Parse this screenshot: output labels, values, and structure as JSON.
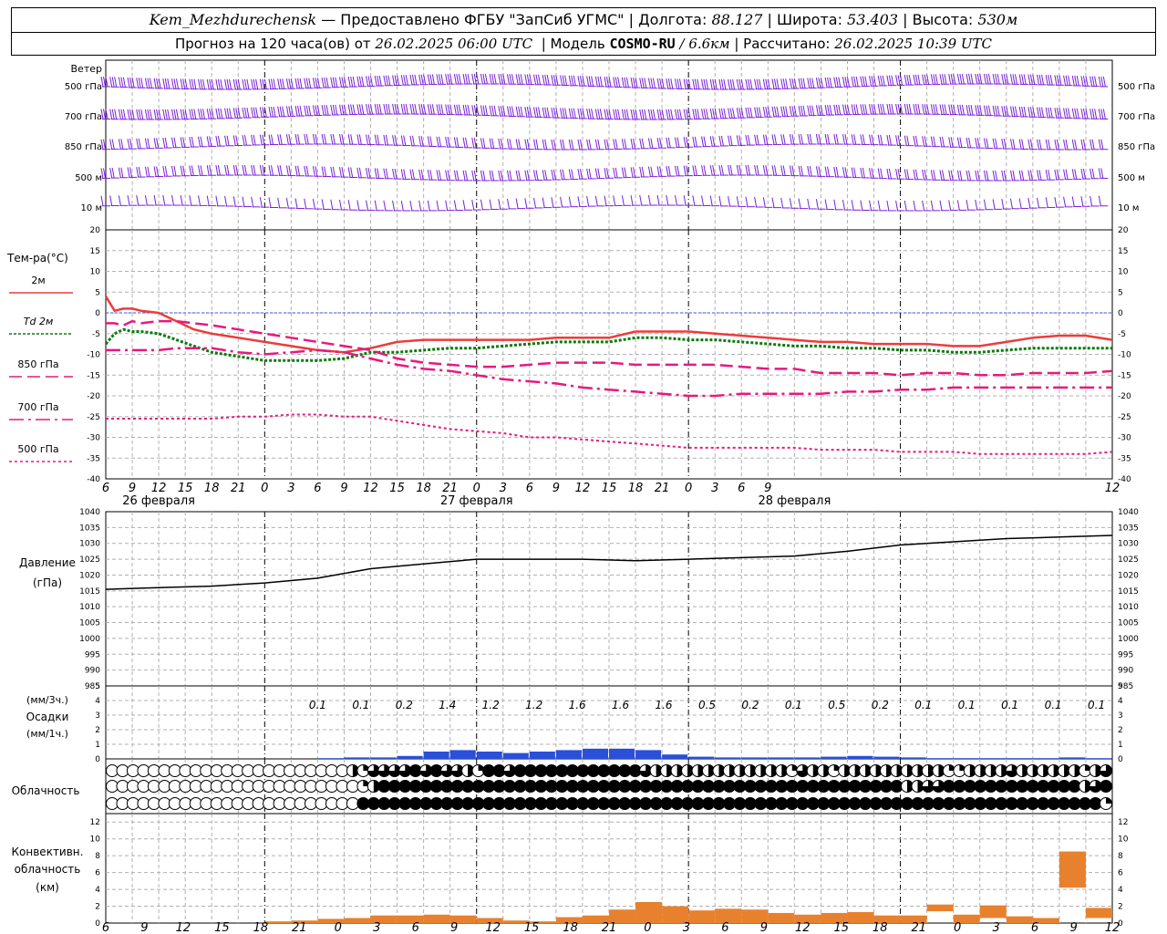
{
  "header": {
    "station": "Kem_Mezhdurechensk",
    "provider": "— Предоставлено ФГБУ \"ЗапСиб УГМС\"",
    "lon_label": "Долгота:",
    "lon_value": "88.127",
    "lat_label": "Широта:",
    "lat_value": "53.403",
    "alt_label": "Высота:",
    "alt_value": "530м",
    "forecast_prefix": "Прогноз на 120 часа(ов) от",
    "forecast_start": "26.02.2025 06:00 UTC",
    "model_label": "Модель",
    "model_name": "COSMO-RU",
    "model_res": "/ 6.6км",
    "computed_label": "Рассчитано:",
    "computed_time": "26.02.2025 10:39 UTC"
  },
  "colors": {
    "wind": "#7b1fd8",
    "t2m": "#ee3b3b",
    "td2m": "#0a7a0a",
    "t850": "#e6197e",
    "t700": "#e6197e",
    "t500": "#e6197e",
    "zero_line": "#3355ee",
    "pressure": "#000000",
    "precip": "#2a4fd9",
    "convective": "#e8812e"
  },
  "wind_panel": {
    "title": "Ветер",
    "levels": [
      "500 гПа",
      "700 гПа",
      "850 гПа",
      "500 м",
      "10 м"
    ]
  },
  "temp_panel": {
    "ylabel": "Тем-ра(°C)",
    "legend": [
      {
        "label": "2м",
        "key": "t2m",
        "style": "solid"
      },
      {
        "label": "Td 2м",
        "key": "td2m",
        "style": "dotted"
      },
      {
        "label": "850 гПа",
        "key": "t850",
        "style": "dash"
      },
      {
        "label": "700 гПа",
        "key": "t700",
        "style": "dashdot"
      },
      {
        "label": "500 гПа",
        "key": "t500",
        "style": "dot"
      }
    ],
    "yticks": [
      "20",
      "15",
      "10",
      "5",
      "0",
      "-5",
      "-10",
      "-15",
      "-20",
      "-25",
      "-30",
      "-35",
      "-40"
    ]
  },
  "pressure_panel": {
    "ylabel": "Давление",
    "unit": "(гПа)",
    "yticks": [
      "1040",
      "1035",
      "1030",
      "1025",
      "1020",
      "1015",
      "1010",
      "1005",
      "1000",
      "995",
      "990",
      "985"
    ]
  },
  "precip_panel": {
    "unit_top": "(мм/3ч.)",
    "ylabel": "Осадки",
    "unit_bottom": "(мм/1ч.)",
    "yticks": [
      "5",
      "4",
      "3",
      "2",
      "1",
      "0"
    ],
    "amounts": [
      "0.1",
      "0.1",
      "0.2",
      "1.4",
      "1.2",
      "1.2",
      "1.6",
      "1.6",
      "1.6",
      "0.5",
      "0.2",
      "0.1",
      "0.5",
      "0.2",
      "0.1",
      "0.1",
      "0.1",
      "0.1",
      "0.1"
    ]
  },
  "cloud_panel": {
    "ylabel": "Облачность"
  },
  "conv_panel": {
    "ylabel1": "Конвективн.",
    "ylabel2": "облачность",
    "unit": "(км)",
    "yticks": [
      "12",
      "10",
      "8",
      "6",
      "4",
      "2",
      "0"
    ]
  },
  "time_axis": {
    "hour_labels": [
      "6",
      "9",
      "12",
      "15",
      "18",
      "21",
      "0",
      "3",
      "6",
      "9",
      "12",
      "15",
      "18",
      "21",
      "0",
      "3",
      "6",
      "9",
      "12",
      "15",
      "18",
      "21",
      "0",
      "3",
      "6",
      "9",
      "12"
    ],
    "dates": [
      "26 февраля",
      "27 февраля",
      "28 февраля"
    ]
  },
  "chart_data": [
    {
      "type": "line",
      "title": "Тем-ра(°C)",
      "x_hours_from_start": [
        0,
        1,
        2,
        3,
        4,
        6,
        8,
        10,
        12,
        15,
        18,
        21,
        24,
        27,
        30,
        33,
        36,
        39,
        42,
        45,
        48,
        51,
        54,
        57,
        60,
        63,
        66,
        69,
        72,
        75,
        78,
        81,
        84,
        87,
        90,
        93,
        96,
        99,
        102,
        105,
        108,
        111,
        114
      ],
      "ylim": [
        -40,
        20
      ],
      "series": [
        {
          "name": "2м",
          "key": "t2m",
          "values": [
            4,
            0.5,
            1,
            1,
            0.5,
            0,
            -2,
            -4,
            -5,
            -6,
            -7,
            -8,
            -9,
            -9.5,
            -8.5,
            -7,
            -6.5,
            -6.5,
            -6.5,
            -6.5,
            -6.5,
            -6,
            -6,
            -6,
            -4.5,
            -4.5,
            -4.5,
            -5,
            -5.5,
            -6,
            -6.5,
            -7,
            -7,
            -7.5,
            -7.5,
            -7.5,
            -8,
            -8,
            -7,
            -6,
            -5.5,
            -5.5,
            -6.5
          ]
        },
        {
          "name": "Td 2м",
          "key": "td2m",
          "values": [
            -7.5,
            -5,
            -4,
            -4.5,
            -4.5,
            -5,
            -6.5,
            -8,
            -9.5,
            -10.5,
            -11.5,
            -11.5,
            -11.5,
            -11,
            -9.5,
            -9.5,
            -9,
            -8.5,
            -8.5,
            -8,
            -7.5,
            -7,
            -7,
            -7,
            -6,
            -6,
            -6.5,
            -6.5,
            -7,
            -7.5,
            -8,
            -8,
            -8.5,
            -8.5,
            -9,
            -9,
            -9.5,
            -9.5,
            -9,
            -8.5,
            -8.5,
            -8.5,
            -8.5
          ]
        },
        {
          "name": "850 гПа",
          "key": "t850",
          "values": [
            -2.5,
            -2.5,
            -3,
            -2,
            -2.5,
            -2,
            -2,
            -2.5,
            -3,
            -4,
            -5,
            -6,
            -7,
            -8,
            -9,
            -11,
            -12,
            -12.5,
            -13,
            -13,
            -12.5,
            -12,
            -12,
            -12,
            -12.5,
            -12.5,
            -12.5,
            -12.5,
            -13,
            -13.5,
            -13.5,
            -14.5,
            -14.5,
            -14.5,
            -15,
            -14.5,
            -14.5,
            -15,
            -15,
            -14.5,
            -14.5,
            -14.5,
            -14
          ]
        },
        {
          "name": "700 гПа",
          "key": "t700",
          "values": [
            -9,
            -9,
            -9,
            -9,
            -9,
            -9,
            -8.5,
            -8.5,
            -8.5,
            -9.5,
            -10,
            -9.5,
            -9,
            -9.5,
            -11,
            -12.5,
            -13.5,
            -14,
            -15,
            -16,
            -16.5,
            -17,
            -18,
            -18.5,
            -19,
            -19.5,
            -20,
            -20,
            -19.5,
            -19.5,
            -19.5,
            -19.5,
            -19,
            -19,
            -18.5,
            -18.5,
            -18,
            -18,
            -18,
            -18,
            -18,
            -18,
            -18
          ]
        },
        {
          "name": "500 гПа",
          "key": "t500",
          "values": [
            -25.5,
            -25.5,
            -25.5,
            -25.5,
            -25.5,
            -25.5,
            -25.5,
            -25.5,
            -25.5,
            -25,
            -25,
            -24.5,
            -24.5,
            -25,
            -25,
            -26,
            -27,
            -28,
            -28.5,
            -29,
            -30,
            -30,
            -30.5,
            -31,
            -31.5,
            -32,
            -32.5,
            -32.5,
            -32.5,
            -32.5,
            -32.5,
            -33,
            -33,
            -33,
            -33.5,
            -33.5,
            -33.5,
            -34,
            -34,
            -34,
            -34,
            -34,
            -33.5
          ]
        }
      ]
    },
    {
      "type": "line",
      "title": "Давление",
      "ylabel": "(гПа)",
      "ylim": [
        985,
        1040
      ],
      "x_hours_from_start": [
        0,
        6,
        12,
        18,
        24,
        30,
        36,
        42,
        48,
        54,
        60,
        66,
        72,
        78,
        84,
        90,
        96,
        102,
        108,
        114
      ],
      "series": [
        {
          "name": "Давление",
          "key": "pressure",
          "values": [
            1015.5,
            1016,
            1016.5,
            1017.5,
            1019,
            1022,
            1023.5,
            1025,
            1025,
            1025,
            1024.5,
            1025,
            1025.5,
            1026,
            1027.5,
            1029.5,
            1030.5,
            1031.5,
            1032,
            1032.5
          ]
        }
      ]
    },
    {
      "type": "bar",
      "title": "Осадки",
      "ylabel": "(мм/1ч.)",
      "ylim": [
        0,
        5
      ],
      "x_hours_from_start": [
        21,
        24,
        27,
        30,
        33,
        36,
        39,
        42,
        45,
        48,
        51,
        54,
        57,
        60,
        63,
        66,
        69,
        72,
        75,
        78,
        81,
        84,
        87,
        90,
        93,
        96,
        99,
        102,
        105,
        108,
        111
      ],
      "values": [
        0,
        0.05,
        0.1,
        0.1,
        0.2,
        0.5,
        0.6,
        0.5,
        0.4,
        0.5,
        0.6,
        0.7,
        0.7,
        0.6,
        0.3,
        0.15,
        0.1,
        0.1,
        0.1,
        0.1,
        0.15,
        0.2,
        0.15,
        0.1,
        0.05,
        0.05,
        0.05,
        0.05,
        0.05,
        0.1,
        0.05
      ]
    },
    {
      "type": "bar",
      "title": "Конвективн. облачность",
      "ylabel": "(км)",
      "ylim": [
        0,
        13
      ],
      "x_hours_from_start": [
        18,
        21,
        24,
        27,
        30,
        33,
        36,
        39,
        42,
        45,
        48,
        51,
        54,
        57,
        60,
        63,
        66,
        69,
        72,
        75,
        78,
        81,
        84,
        87,
        90,
        93,
        96,
        99,
        102,
        105,
        108,
        111
      ],
      "values": [
        0.2,
        0.3,
        0.5,
        0.6,
        0.9,
        0.9,
        1.0,
        0.9,
        0.6,
        0.3,
        0.2,
        0.7,
        0.9,
        1.6,
        2.5,
        2.0,
        1.5,
        1.7,
        1.6,
        1.2,
        1.0,
        1.2,
        1.3,
        0.9,
        0.9,
        0.8,
        1.0,
        1.5,
        0.8,
        0.6,
        4.3,
        1.2
      ],
      "bases": [
        0,
        0,
        0,
        0,
        0,
        0,
        0,
        0,
        0,
        0,
        0,
        0,
        0,
        0,
        0,
        0,
        0,
        0,
        0,
        0,
        0,
        0,
        0,
        0,
        0,
        1.4,
        0,
        0.6,
        0,
        0,
        4.2,
        0.6
      ]
    }
  ],
  "cloud_cover": {
    "rows_octas": [
      [
        0,
        0,
        0,
        0,
        0,
        0,
        0,
        0,
        0,
        0,
        0,
        0,
        0,
        0,
        0,
        0,
        0,
        0,
        0,
        0,
        0,
        0,
        0,
        4,
        2,
        6,
        6,
        6,
        6,
        8,
        6,
        8,
        6,
        6,
        4,
        2,
        8,
        8,
        6,
        8,
        8,
        8,
        8,
        8,
        8,
        8,
        8,
        8,
        8,
        8,
        8,
        6,
        4,
        4,
        4,
        4,
        4,
        4,
        4,
        4,
        4,
        4,
        4,
        4,
        4,
        2,
        6,
        4,
        4,
        2,
        4,
        4,
        4,
        4,
        4,
        4,
        4,
        4,
        4,
        4,
        2,
        2,
        4,
        4,
        4,
        4,
        6,
        4,
        4,
        4,
        4,
        4,
        4,
        2,
        4,
        6
      ],
      [
        0,
        0,
        0,
        0,
        0,
        0,
        0,
        0,
        0,
        0,
        0,
        0,
        0,
        0,
        0,
        0,
        0,
        0,
        0,
        0,
        0,
        0,
        0,
        0,
        2,
        4,
        8,
        8,
        8,
        8,
        8,
        8,
        8,
        8,
        8,
        8,
        8,
        8,
        8,
        8,
        8,
        8,
        8,
        8,
        8,
        8,
        8,
        8,
        8,
        8,
        8,
        8,
        8,
        8,
        8,
        8,
        8,
        8,
        8,
        8,
        8,
        8,
        8,
        8,
        8,
        8,
        8,
        8,
        8,
        8,
        8,
        8,
        8,
        8,
        8,
        8,
        4,
        4,
        6,
        6,
        8,
        8,
        8,
        8,
        8,
        8,
        8,
        8,
        8,
        8,
        8,
        8,
        8,
        4,
        6,
        8
      ],
      [
        0,
        0,
        0,
        0,
        0,
        0,
        0,
        0,
        0,
        0,
        0,
        0,
        0,
        0,
        0,
        0,
        0,
        0,
        0,
        0,
        0,
        0,
        0,
        0,
        8,
        8,
        8,
        8,
        8,
        8,
        8,
        8,
        8,
        8,
        8,
        8,
        8,
        8,
        8,
        8,
        8,
        8,
        8,
        8,
        8,
        8,
        8,
        8,
        8,
        8,
        8,
        8,
        8,
        8,
        8,
        8,
        8,
        8,
        8,
        8,
        8,
        8,
        8,
        8,
        8,
        8,
        8,
        8,
        8,
        8,
        8,
        8,
        8,
        8,
        8,
        8,
        8,
        8,
        8,
        8,
        8,
        8,
        8,
        8,
        8,
        8,
        8,
        8,
        8,
        8,
        8,
        8,
        8,
        8,
        8,
        2
      ]
    ]
  }
}
